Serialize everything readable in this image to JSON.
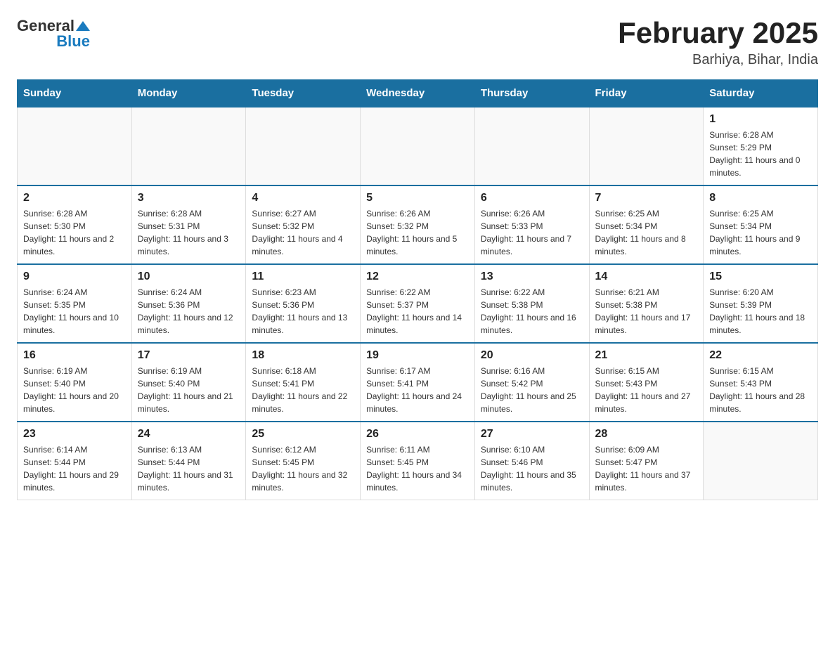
{
  "logo": {
    "general": "General",
    "blue": "Blue"
  },
  "calendar": {
    "title": "February 2025",
    "subtitle": "Barhiya, Bihar, India"
  },
  "headers": [
    "Sunday",
    "Monday",
    "Tuesday",
    "Wednesday",
    "Thursday",
    "Friday",
    "Saturday"
  ],
  "weeks": [
    [
      {
        "day": "",
        "info": ""
      },
      {
        "day": "",
        "info": ""
      },
      {
        "day": "",
        "info": ""
      },
      {
        "day": "",
        "info": ""
      },
      {
        "day": "",
        "info": ""
      },
      {
        "day": "",
        "info": ""
      },
      {
        "day": "1",
        "info": "Sunrise: 6:28 AM\nSunset: 5:29 PM\nDaylight: 11 hours and 0 minutes."
      }
    ],
    [
      {
        "day": "2",
        "info": "Sunrise: 6:28 AM\nSunset: 5:30 PM\nDaylight: 11 hours and 2 minutes."
      },
      {
        "day": "3",
        "info": "Sunrise: 6:28 AM\nSunset: 5:31 PM\nDaylight: 11 hours and 3 minutes."
      },
      {
        "day": "4",
        "info": "Sunrise: 6:27 AM\nSunset: 5:32 PM\nDaylight: 11 hours and 4 minutes."
      },
      {
        "day": "5",
        "info": "Sunrise: 6:26 AM\nSunset: 5:32 PM\nDaylight: 11 hours and 5 minutes."
      },
      {
        "day": "6",
        "info": "Sunrise: 6:26 AM\nSunset: 5:33 PM\nDaylight: 11 hours and 7 minutes."
      },
      {
        "day": "7",
        "info": "Sunrise: 6:25 AM\nSunset: 5:34 PM\nDaylight: 11 hours and 8 minutes."
      },
      {
        "day": "8",
        "info": "Sunrise: 6:25 AM\nSunset: 5:34 PM\nDaylight: 11 hours and 9 minutes."
      }
    ],
    [
      {
        "day": "9",
        "info": "Sunrise: 6:24 AM\nSunset: 5:35 PM\nDaylight: 11 hours and 10 minutes."
      },
      {
        "day": "10",
        "info": "Sunrise: 6:24 AM\nSunset: 5:36 PM\nDaylight: 11 hours and 12 minutes."
      },
      {
        "day": "11",
        "info": "Sunrise: 6:23 AM\nSunset: 5:36 PM\nDaylight: 11 hours and 13 minutes."
      },
      {
        "day": "12",
        "info": "Sunrise: 6:22 AM\nSunset: 5:37 PM\nDaylight: 11 hours and 14 minutes."
      },
      {
        "day": "13",
        "info": "Sunrise: 6:22 AM\nSunset: 5:38 PM\nDaylight: 11 hours and 16 minutes."
      },
      {
        "day": "14",
        "info": "Sunrise: 6:21 AM\nSunset: 5:38 PM\nDaylight: 11 hours and 17 minutes."
      },
      {
        "day": "15",
        "info": "Sunrise: 6:20 AM\nSunset: 5:39 PM\nDaylight: 11 hours and 18 minutes."
      }
    ],
    [
      {
        "day": "16",
        "info": "Sunrise: 6:19 AM\nSunset: 5:40 PM\nDaylight: 11 hours and 20 minutes."
      },
      {
        "day": "17",
        "info": "Sunrise: 6:19 AM\nSunset: 5:40 PM\nDaylight: 11 hours and 21 minutes."
      },
      {
        "day": "18",
        "info": "Sunrise: 6:18 AM\nSunset: 5:41 PM\nDaylight: 11 hours and 22 minutes."
      },
      {
        "day": "19",
        "info": "Sunrise: 6:17 AM\nSunset: 5:41 PM\nDaylight: 11 hours and 24 minutes."
      },
      {
        "day": "20",
        "info": "Sunrise: 6:16 AM\nSunset: 5:42 PM\nDaylight: 11 hours and 25 minutes."
      },
      {
        "day": "21",
        "info": "Sunrise: 6:15 AM\nSunset: 5:43 PM\nDaylight: 11 hours and 27 minutes."
      },
      {
        "day": "22",
        "info": "Sunrise: 6:15 AM\nSunset: 5:43 PM\nDaylight: 11 hours and 28 minutes."
      }
    ],
    [
      {
        "day": "23",
        "info": "Sunrise: 6:14 AM\nSunset: 5:44 PM\nDaylight: 11 hours and 29 minutes."
      },
      {
        "day": "24",
        "info": "Sunrise: 6:13 AM\nSunset: 5:44 PM\nDaylight: 11 hours and 31 minutes."
      },
      {
        "day": "25",
        "info": "Sunrise: 6:12 AM\nSunset: 5:45 PM\nDaylight: 11 hours and 32 minutes."
      },
      {
        "day": "26",
        "info": "Sunrise: 6:11 AM\nSunset: 5:45 PM\nDaylight: 11 hours and 34 minutes."
      },
      {
        "day": "27",
        "info": "Sunrise: 6:10 AM\nSunset: 5:46 PM\nDaylight: 11 hours and 35 minutes."
      },
      {
        "day": "28",
        "info": "Sunrise: 6:09 AM\nSunset: 5:47 PM\nDaylight: 11 hours and 37 minutes."
      },
      {
        "day": "",
        "info": ""
      }
    ]
  ]
}
